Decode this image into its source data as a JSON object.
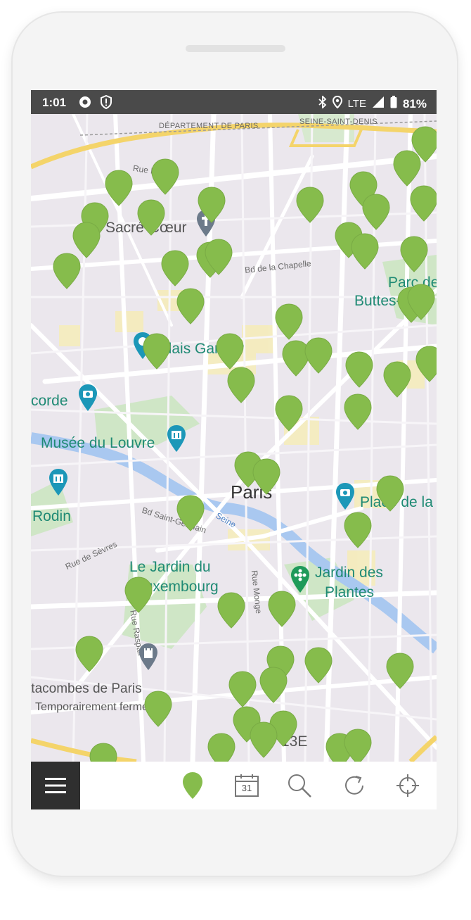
{
  "status_bar": {
    "time": "1:01",
    "network": "LTE",
    "battery": "81%"
  },
  "map": {
    "labels": {
      "departement": "DÉPARTEMENT DE PARIS",
      "seine_saint_denis": "SEINE-SAINT-DENIS",
      "rue_le": "Rue L",
      "sacre_coeur": "Sacré-Cœur",
      "bd_chapelle": "Bd de la Chapelle",
      "parc_de": "Parc de",
      "buttes": "Buttes-Ch",
      "palais_garnier": "Palais Garnier",
      "concorde": "corde",
      "musee_louvre": "Musée du Louvre",
      "paris": "Paris",
      "rodin": "Rodin",
      "bd_saint_germain": "Bd Saint-Germain",
      "seine": "Seine",
      "place_de_la": "Place de la",
      "rue_sevres": "Rue de Sèvres",
      "jardin_luxembourg_1": "Le Jardin du",
      "jardin_luxembourg_2": "Luxembourg",
      "rue_monge": "Rue Monge",
      "jardin_plantes_1": "Jardin des",
      "jardin_plantes_2": "Plantes",
      "rue_raspail": "Rue Raspail",
      "catacombes": "Catacombes de Paris",
      "temporairement": "Temporairement fermé",
      "arrondissement": "13E"
    }
  },
  "toolbar": {
    "calendar_day": "31"
  },
  "colors": {
    "pin": "#86bc4c",
    "poi": "#1f8a74",
    "status_bar": "#4a4a4a"
  }
}
